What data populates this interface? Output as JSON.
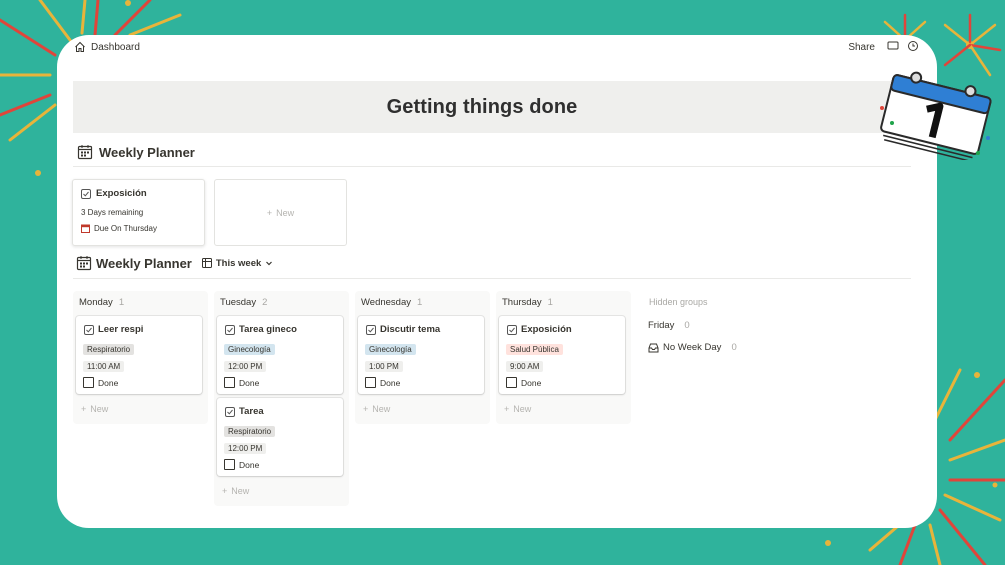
{
  "header": {
    "breadcrumb": "Dashboard",
    "share_label": "Share"
  },
  "banner": {
    "title": "Getting things done"
  },
  "gallery": {
    "title": "Weekly Planner",
    "card": {
      "title": "Exposición",
      "remaining": "3 Days remaining",
      "due": "Due On Thursday"
    },
    "new_label": "New"
  },
  "board": {
    "title": "Weekly Planner",
    "view_tab": "This week",
    "columns": [
      {
        "name": "Monday",
        "count": "1",
        "cards": [
          {
            "title": "Leer respi",
            "tag": "Respiratorio",
            "time": "11:00 AM",
            "done_label": "Done"
          }
        ],
        "new_label": "New"
      },
      {
        "name": "Tuesday",
        "count": "2",
        "cards": [
          {
            "title": "Tarea gineco",
            "tag": "Ginecología",
            "time": "12:00 PM",
            "done_label": "Done"
          },
          {
            "title": "Tarea",
            "tag": "Respiratorio",
            "time": "12:00 PM",
            "done_label": "Done"
          }
        ],
        "new_label": "New"
      },
      {
        "name": "Wednesday",
        "count": "1",
        "cards": [
          {
            "title": "Discutir tema",
            "tag": "Ginecología",
            "time": "1:00 PM",
            "done_label": "Done"
          }
        ],
        "new_label": "New"
      },
      {
        "name": "Thursday",
        "count": "1",
        "cards": [
          {
            "title": "Exposición",
            "tag": "Salud Pública",
            "time": "9:00 AM",
            "done_label": "Done"
          }
        ],
        "new_label": "New"
      }
    ],
    "hidden_groups": {
      "label": "Hidden groups",
      "items": [
        {
          "name": "Friday",
          "count": "0"
        },
        {
          "name": "No Week Day",
          "count": "0"
        }
      ]
    }
  },
  "colors": {
    "background": "#2fb39c",
    "tag_gray": "#e3e2e0",
    "tag_blue": "#d3e5ef",
    "tag_red": "#ffe2dd",
    "firework_red": "#e0453a",
    "firework_gold": "#e8b43a"
  },
  "icons": {
    "breadcrumb": "home-icon",
    "gallery_title": "calendar-icon",
    "card_check": "checkbox-icon",
    "due": "calendar-small-icon",
    "view_tab": "board-view-icon",
    "no_week_day": "inbox-icon",
    "sticker": "calendar-sticker-icon"
  }
}
